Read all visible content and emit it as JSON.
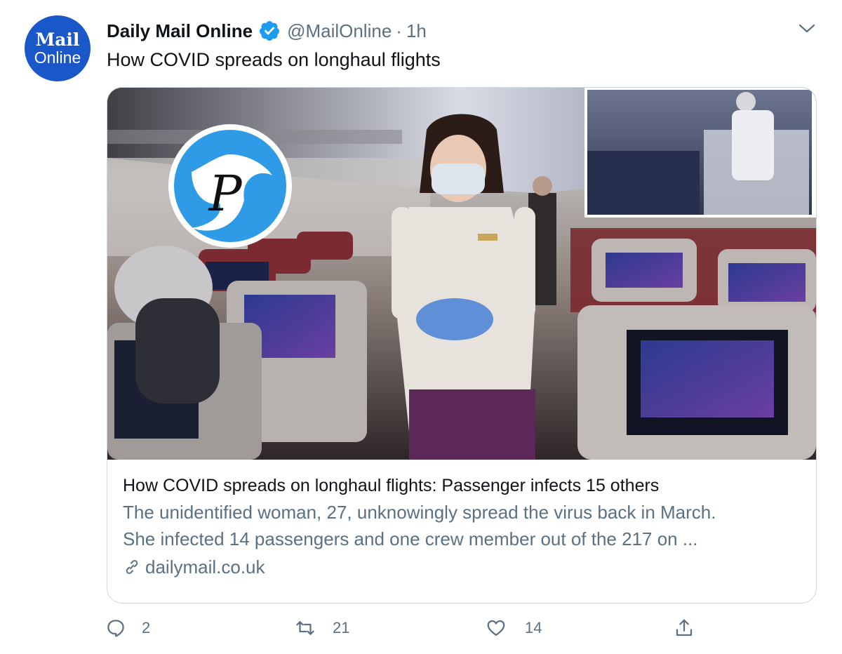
{
  "author": {
    "avatar_line1": "Mail",
    "avatar_line2": "Online",
    "display_name": "Daily Mail Online",
    "handle": "@MailOnline",
    "separator": "·",
    "time": "1h"
  },
  "tweet": {
    "text": "How COVID spreads on longhaul flights"
  },
  "card": {
    "title": "How COVID spreads on longhaul flights: Passenger infects 15 others",
    "description_line1": "The unidentified woman, 27, unknowingly spread the virus back in March.",
    "description_line2": "She infected 14 passengers and one crew member out of the 217 on ...",
    "domain": "dailymail.co.uk",
    "watermark_letter": "P"
  },
  "actions": {
    "reply_count": "2",
    "retweet_count": "21",
    "like_count": "14"
  },
  "colors": {
    "brand_blue": "#1d9bf0",
    "avatar_blue": "#1a57c8",
    "secondary_text": "#5b7083",
    "border": "#cfd9de"
  }
}
